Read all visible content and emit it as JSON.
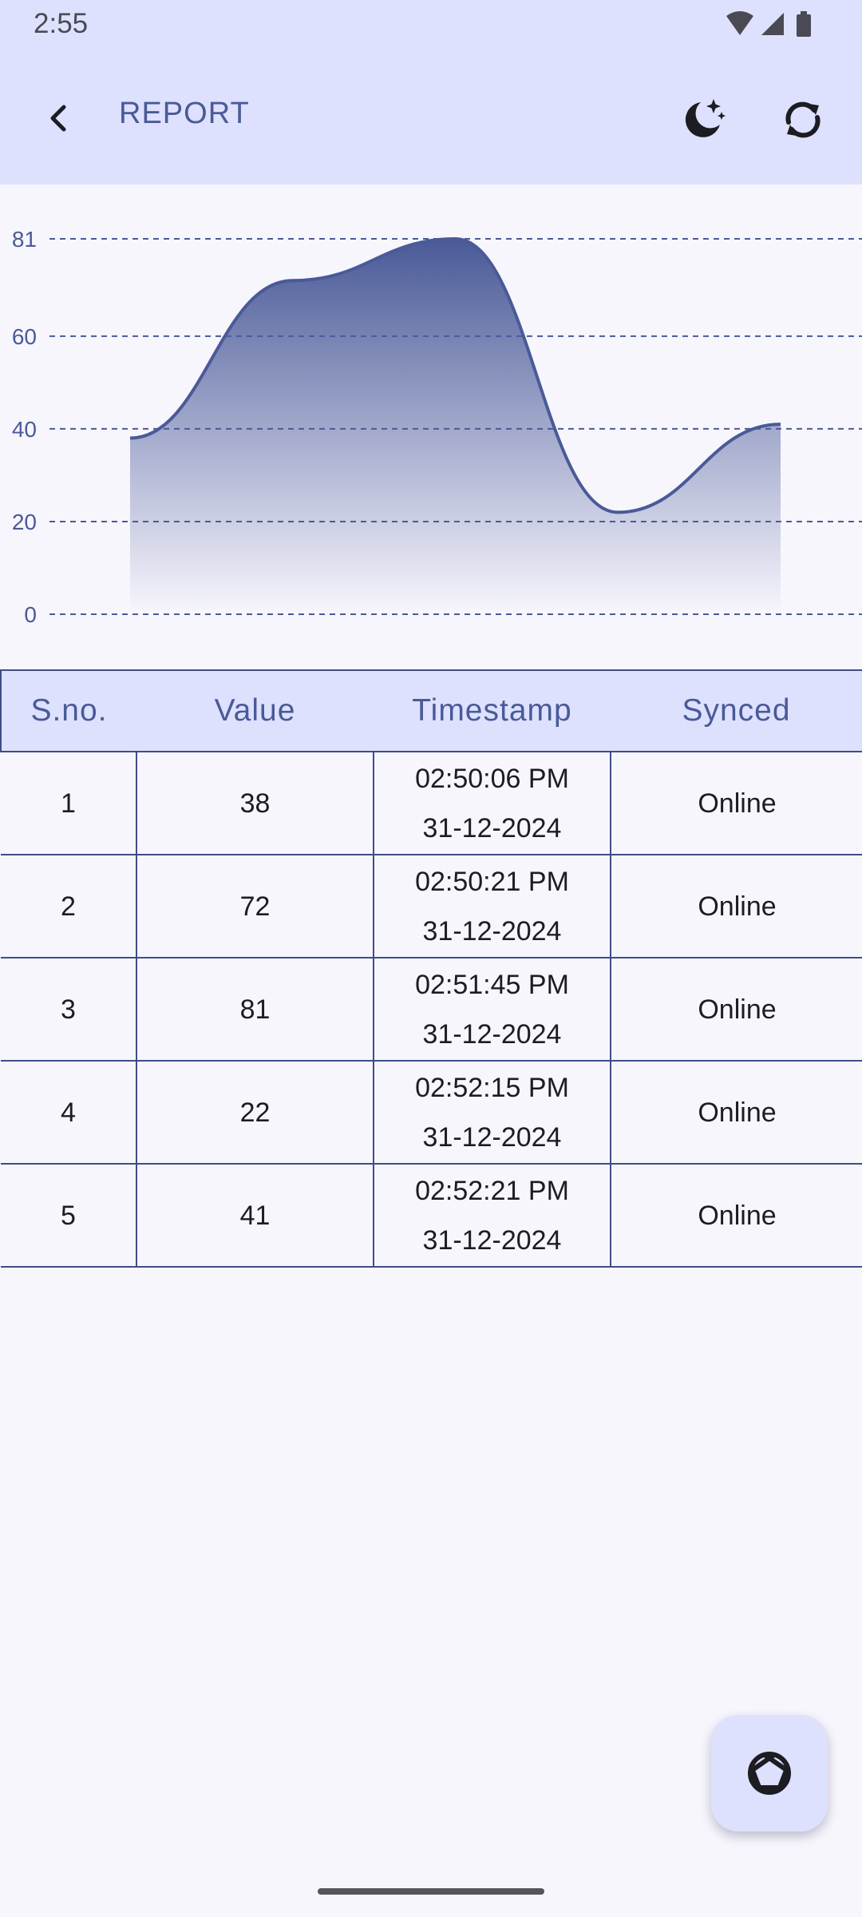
{
  "status_bar": {
    "time": "2:55",
    "icons": [
      "wifi-icon",
      "cell-signal-icon",
      "battery-icon"
    ]
  },
  "app_bar": {
    "title": "REPORT",
    "back_icon": "chevron-left-icon",
    "theme_icon": "moon-stars-icon",
    "refresh_icon": "refresh-icon"
  },
  "colors": {
    "app_bar_bg": "#dde1fd",
    "page_bg": "#f7f6fd",
    "accent": "#4a5a98",
    "line": "#4a5a98",
    "table_border": "#3f4d86"
  },
  "chart_data": {
    "type": "area",
    "x": [
      1,
      2,
      3,
      4,
      5
    ],
    "values": [
      38,
      72,
      81,
      22,
      41
    ],
    "yticks": [
      "0",
      "20",
      "40",
      "60",
      "81"
    ],
    "ylim": [
      0,
      81
    ],
    "grid": "dashed-horizontal",
    "smooth": true,
    "fill": "gradient"
  },
  "table": {
    "headers": [
      "S.no.",
      "Value",
      "Timestamp",
      "Synced"
    ],
    "rows": [
      {
        "sno": "1",
        "value": "38",
        "time": "02:50:06 PM",
        "date": "31-12-2024",
        "synced": "Online"
      },
      {
        "sno": "2",
        "value": "72",
        "time": "02:50:21 PM",
        "date": "31-12-2024",
        "synced": "Online"
      },
      {
        "sno": "3",
        "value": "81",
        "time": "02:51:45 PM",
        "date": "31-12-2024",
        "synced": "Online"
      },
      {
        "sno": "4",
        "value": "22",
        "time": "02:52:15 PM",
        "date": "31-12-2024",
        "synced": "Online"
      },
      {
        "sno": "5",
        "value": "41",
        "time": "02:52:21 PM",
        "date": "31-12-2024",
        "synced": "Online"
      }
    ]
  },
  "fab": {
    "icon": "camera-shutter-icon"
  }
}
